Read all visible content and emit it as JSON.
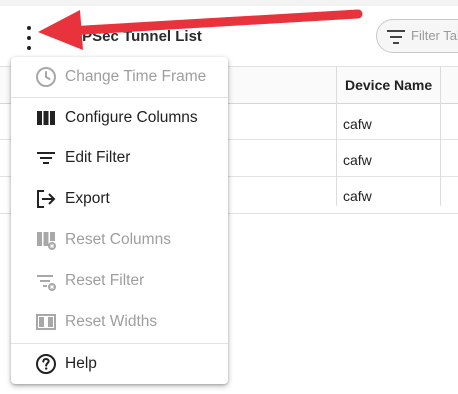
{
  "header": {
    "title": "IPSec Tunnel List",
    "filter_placeholder": "Filter Tab"
  },
  "table": {
    "columns": [
      "Device Name"
    ],
    "rows": [
      {
        "device": "cafw"
      },
      {
        "device": "cafw"
      },
      {
        "device": "cafw"
      }
    ]
  },
  "menu": {
    "items": [
      {
        "label": "Change Time Frame",
        "icon": "clock-icon",
        "enabled": false
      },
      {
        "label": "Configure Columns",
        "icon": "columns-icon",
        "enabled": true
      },
      {
        "label": "Edit Filter",
        "icon": "filter-icon",
        "enabled": true
      },
      {
        "label": "Export",
        "icon": "export-icon",
        "enabled": true
      },
      {
        "label": "Reset Columns",
        "icon": "reset-columns-icon",
        "enabled": false
      },
      {
        "label": "Reset Filter",
        "icon": "reset-filter-icon",
        "enabled": false
      },
      {
        "label": "Reset Widths",
        "icon": "reset-widths-icon",
        "enabled": false
      },
      {
        "label": "Help",
        "icon": "help-icon",
        "enabled": true
      }
    ]
  },
  "colors": {
    "annotation_arrow": "#e8323c",
    "disabled_text": "#9e9e9e",
    "enabled_text": "#212121"
  }
}
